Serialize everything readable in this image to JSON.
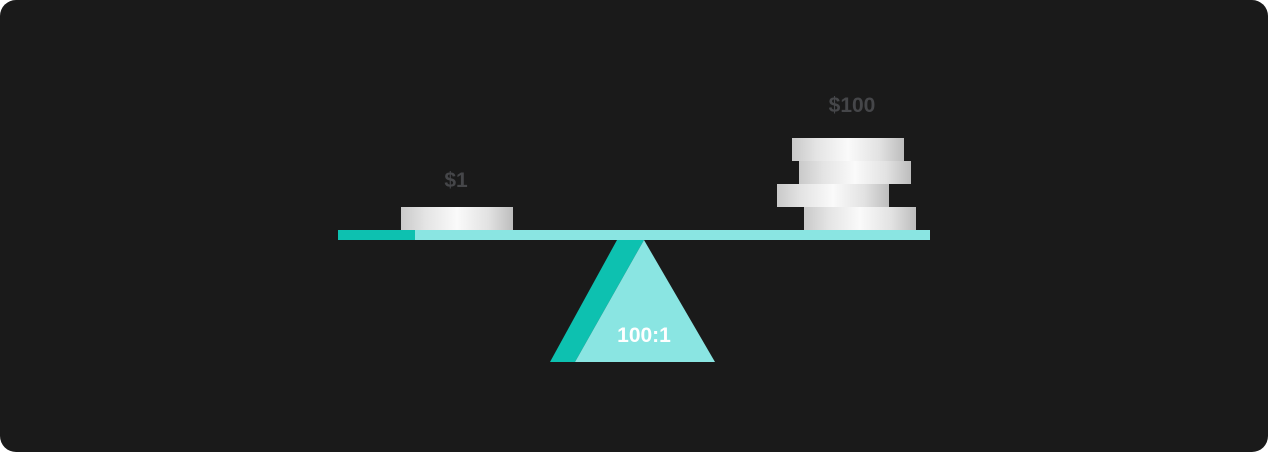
{
  "diagram": {
    "left_label": "$1",
    "right_label": "$100",
    "ratio_label": "100:1",
    "left_coin_count": 1,
    "right_coin_count": 4
  },
  "colors": {
    "background": "#1a1a1a",
    "beam": "#8ae5e2",
    "accent": "#0dc1b0",
    "value_label": "#454649",
    "ratio_text": "#ffffff"
  }
}
